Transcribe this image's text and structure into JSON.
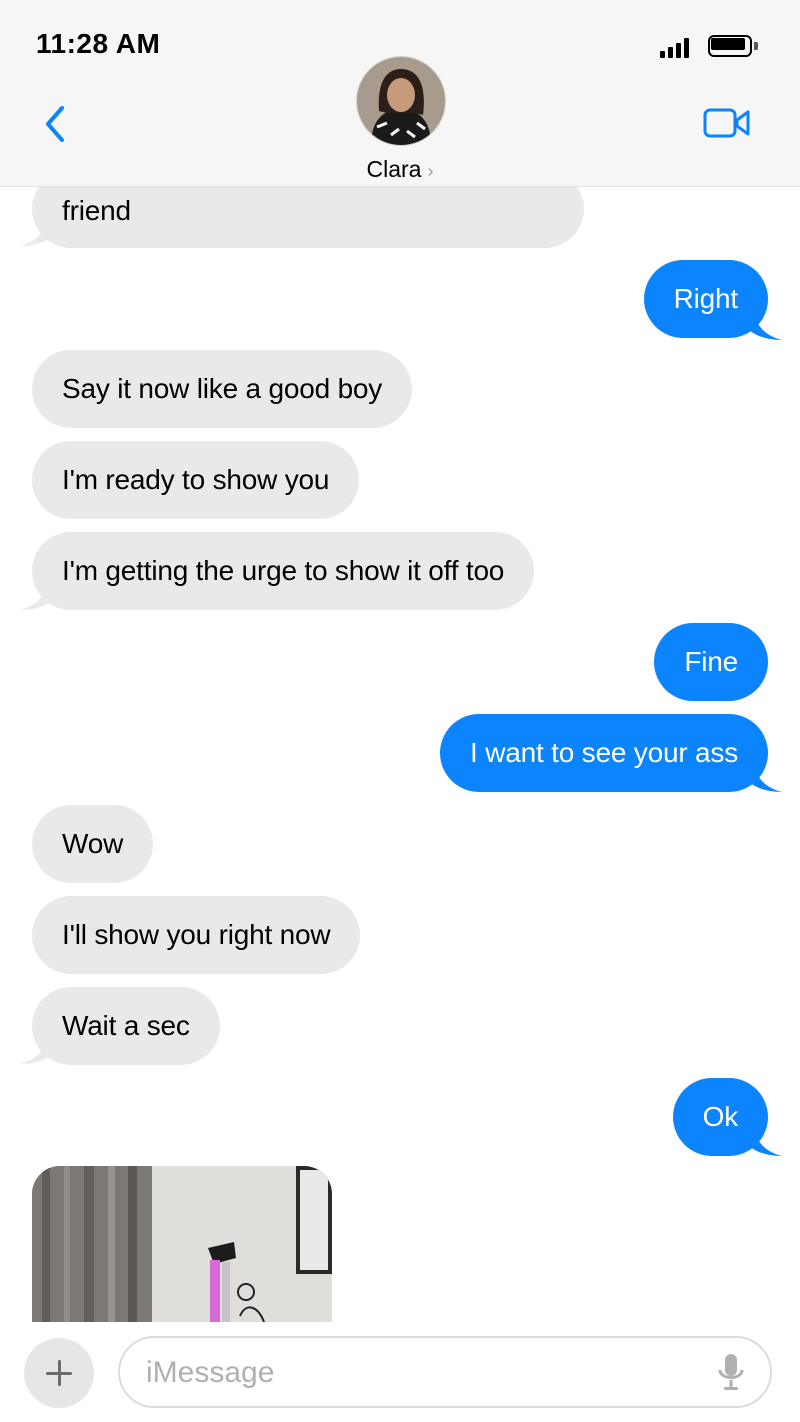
{
  "status_bar": {
    "time": "11:28 AM"
  },
  "header": {
    "contact_name": "Clara",
    "chevron": "›"
  },
  "messages": [
    {
      "side": "in",
      "text": "friend"
    },
    {
      "side": "out",
      "text": "Right"
    },
    {
      "side": "in",
      "text": "Say it now like a good boy"
    },
    {
      "side": "in",
      "text": "I'm ready to show you"
    },
    {
      "side": "in",
      "text": "I'm getting the urge to show it off too"
    },
    {
      "side": "out",
      "text": "Fine"
    },
    {
      "side": "out",
      "text": "I want to see your ass"
    },
    {
      "side": "in",
      "text": "Wow"
    },
    {
      "side": "in",
      "text": "I'll show you right now"
    },
    {
      "side": "in",
      "text": "Wait a sec"
    },
    {
      "side": "out",
      "text": "Ok"
    }
  ],
  "composer": {
    "placeholder": "iMessage"
  },
  "colors": {
    "outgoing_bubble": "#0b84fe",
    "incoming_bubble": "#e9e9eb",
    "accent": "#0b84fe"
  },
  "icons": [
    "back-chevron-icon",
    "video-camera-icon",
    "plus-icon",
    "microphone-icon",
    "signal-icon",
    "battery-icon"
  ]
}
